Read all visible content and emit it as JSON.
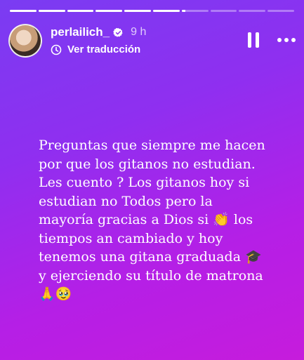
{
  "story": {
    "progress_segments": [
      1,
      1,
      1,
      1,
      1,
      1,
      0.15,
      0,
      0,
      0
    ],
    "user": {
      "username": "perlailich_",
      "time": "9 h",
      "verified": true
    },
    "translate_label": "Ver traducción",
    "caption": "Preguntas que siempre me hacen por que los gitanos no estudian. Les cuento ?  Los gitanos hoy si estudian no Todos pero la mayoría gracias a Dios si 👏 los tiempos an cambiado y hoy tenemos una gitana graduada 🎓 y ejerciendo su título de matrona 🙏🥹"
  },
  "icons": {
    "verified": "verified-badge-icon",
    "translate": "translate-icon",
    "pause": "pause-icon",
    "more": "more-options-icon"
  },
  "colors": {
    "gradient_start": "#7a3cf2",
    "gradient_end": "#c61cdc",
    "text": "#ffffff"
  }
}
